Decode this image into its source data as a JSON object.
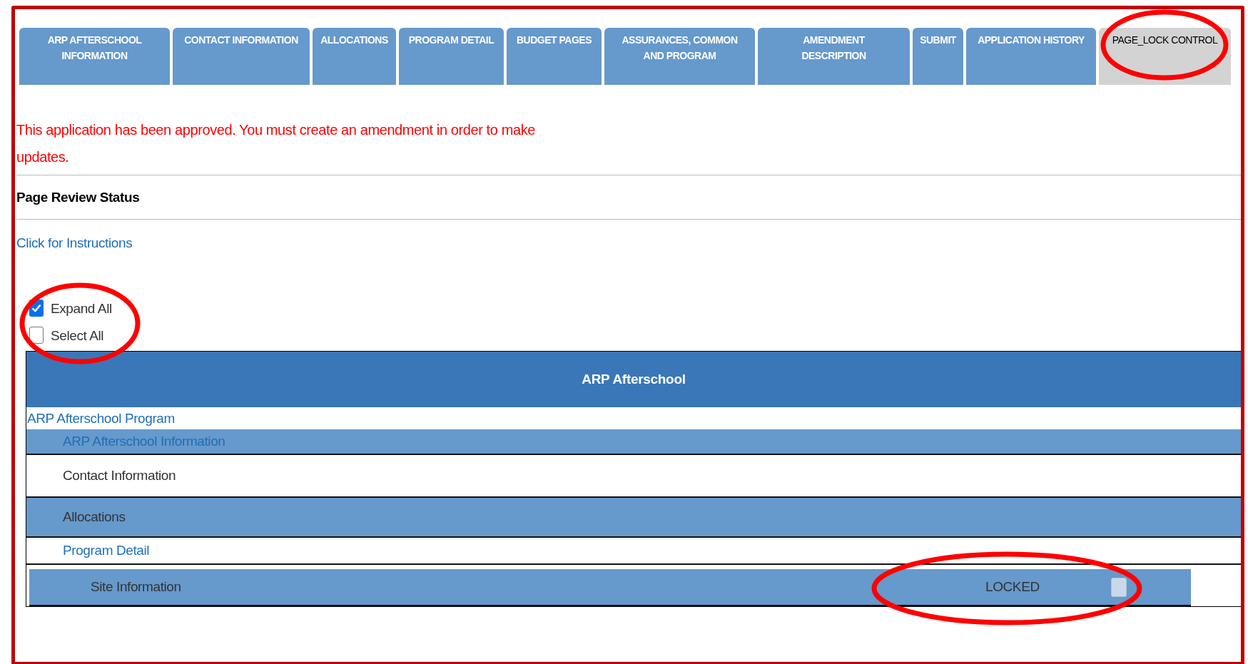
{
  "tabs": [
    {
      "label": "ARP AFTERSCHOOL INFORMATION",
      "selected": false,
      "highlighted": false
    },
    {
      "label": "CONTACT INFORMATION",
      "selected": false,
      "highlighted": false
    },
    {
      "label": "ALLOCATIONS",
      "selected": false,
      "highlighted": false
    },
    {
      "label": "PROGRAM DETAIL",
      "selected": false,
      "highlighted": false
    },
    {
      "label": "BUDGET PAGES",
      "selected": false,
      "highlighted": false
    },
    {
      "label": "ASSURANCES, COMMON AND PROGRAM",
      "selected": false,
      "highlighted": false
    },
    {
      "label": "AMENDMENT DESCRIPTION",
      "selected": false,
      "highlighted": false
    },
    {
      "label": "SUBMIT",
      "selected": false,
      "highlighted": false
    },
    {
      "label": "APPLICATION HISTORY",
      "selected": false,
      "highlighted": false
    },
    {
      "label": "PAGE_LOCK CONTROL",
      "selected": true,
      "highlighted": true
    }
  ],
  "message": "This application has been approved. You must create an amendment in order to make updates.",
  "section_title": "Page Review Status",
  "instructions_link": "Click for Instructions",
  "options": {
    "highlighted": true,
    "items": [
      {
        "label": "Expand All",
        "checked": true
      },
      {
        "label": "Select All",
        "checked": false
      }
    ]
  },
  "table": {
    "title": "ARP Afterschool",
    "tree": [
      {
        "label": "ARP Afterschool Program",
        "kind": "link",
        "children": [
          {
            "label": "ARP Afterschool Information",
            "kind": "link"
          },
          {
            "label": "Contact Information",
            "kind": "text"
          },
          {
            "label": "Allocations",
            "kind": "text"
          },
          {
            "label": "Program Detail",
            "kind": "link",
            "children": [
              {
                "label": "Site Information",
                "kind": "text",
                "lock": {
                  "label": "LOCKED",
                  "checked": false,
                  "disabled": true,
                  "highlighted": true
                }
              }
            ]
          }
        ]
      }
    ]
  }
}
